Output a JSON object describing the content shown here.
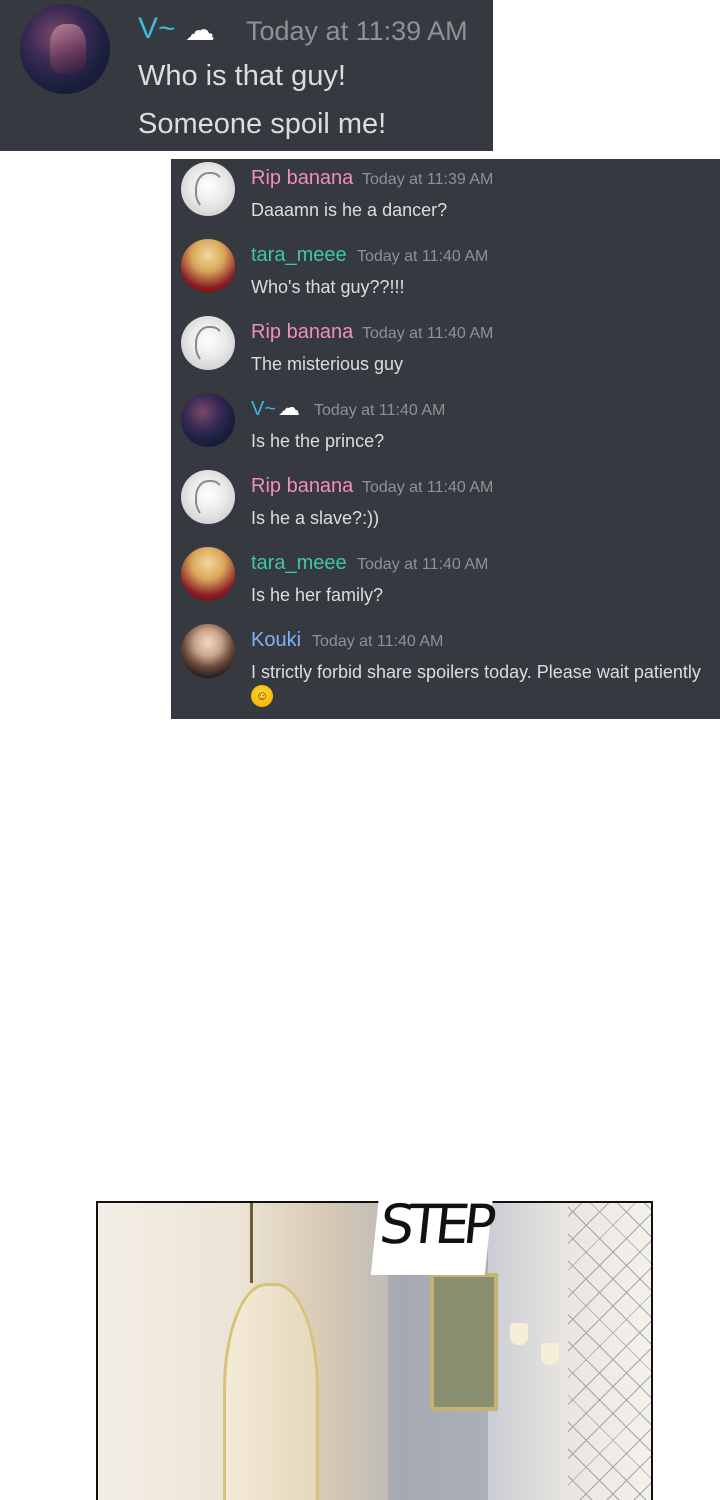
{
  "top_message": {
    "username": "V~",
    "status_icon": "thought-cloud",
    "timestamp": "Today at 11:39 AM",
    "lines": [
      "Who is that guy!",
      "Someone spoil me!"
    ]
  },
  "chat": {
    "messages": [
      {
        "avatar": "rip-banana-avatar",
        "username": "Rip banana",
        "timestamp": "Today at 11:39 AM",
        "text": "Daaamn is he a dancer?"
      },
      {
        "avatar": "tara-meee-avatar",
        "username": "tara_meee",
        "timestamp": "Today at 11:40 AM",
        "text": "Who's that guy??!!!"
      },
      {
        "avatar": "rip-banana-avatar",
        "username": "Rip banana",
        "timestamp": "Today at 11:40 AM",
        "text": "The misterious guy"
      },
      {
        "avatar": "v-avatar",
        "username": "V~",
        "timestamp": "Today at 11:40 AM",
        "text": "Is he the prince?"
      },
      {
        "avatar": "rip-banana-avatar",
        "username": "Rip banana",
        "timestamp": "Today at 11:40 AM",
        "text": "Is he a slave?:))"
      },
      {
        "avatar": "tara-meee-avatar",
        "username": "tara_meee",
        "timestamp": "Today at 11:40 AM",
        "text": "Is he her family?"
      },
      {
        "avatar": "kouki-avatar",
        "username": "Kouki",
        "timestamp": "Today at 11:40 AM",
        "text": "I strictly forbid share spoilers today. Please wait patiently",
        "emoji": "rolling-on-floor-laughing"
      }
    ]
  },
  "colors": {
    "chat_bg": "#36393f",
    "timestamp": "#8e9297",
    "text": "#dcddde",
    "rip_banana": "#f08ec0",
    "tara_meee": "#3fc6a6",
    "v": "#3fb9d8",
    "kouki": "#7fb3f0"
  },
  "comic": {
    "sfx": "STEP"
  }
}
